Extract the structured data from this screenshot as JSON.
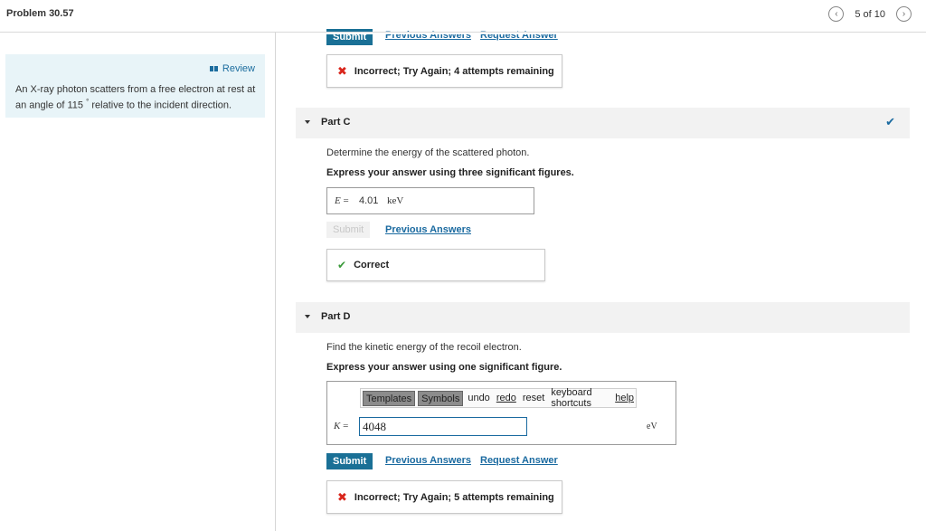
{
  "header": {
    "problem_title": "Problem 30.57",
    "pager_label": "5 of 10",
    "prev_glyph": "‹",
    "next_glyph": "›"
  },
  "sidebar": {
    "review_label": "Review",
    "problem_text_before": "An X-ray photon scatters from a free electron at rest at an angle of 115 ",
    "degree_symbol": "°",
    "problem_text_after": " relative to the incident direction."
  },
  "part_b_tail": {
    "submit_label": "Submit",
    "previous_answers_label": "Previous Answers",
    "request_answer_label": "Request Answer",
    "feedback_icon": "✖",
    "feedback_text": "Incorrect; Try Again; 4 attempts remaining"
  },
  "part_c": {
    "title": "Part C",
    "status_icon": "✔",
    "prompt": "Determine the energy of the scattered photon.",
    "instruction": "Express your answer using three significant figures.",
    "answer_variable": "E",
    "answer_equals": " = ",
    "answer_value": "4.01",
    "answer_unit": "keV",
    "submit_label": "Submit",
    "previous_answers_label": "Previous Answers",
    "feedback_icon": "✔",
    "feedback_text": "Correct"
  },
  "part_d": {
    "title": "Part D",
    "prompt": "Find the kinetic energy of the recoil electron.",
    "instruction": "Express your answer using one significant figure.",
    "toolbar": {
      "templates_label": "Templates",
      "symbols_label": "Symbols",
      "undo_label": "undo",
      "redo_label": "redo",
      "reset_label": "reset",
      "keyboard_shortcuts_label": "keyboard shortcuts",
      "help_label": "help"
    },
    "answer_variable": "K",
    "answer_equals": " = ",
    "answer_value": "4048",
    "answer_unit": "eV",
    "submit_label": "Submit",
    "previous_answers_label": "Previous Answers",
    "request_answer_label": "Request Answer",
    "feedback_icon": "✖",
    "feedback_text": "Incorrect; Try Again; 5 attempts remaining"
  }
}
